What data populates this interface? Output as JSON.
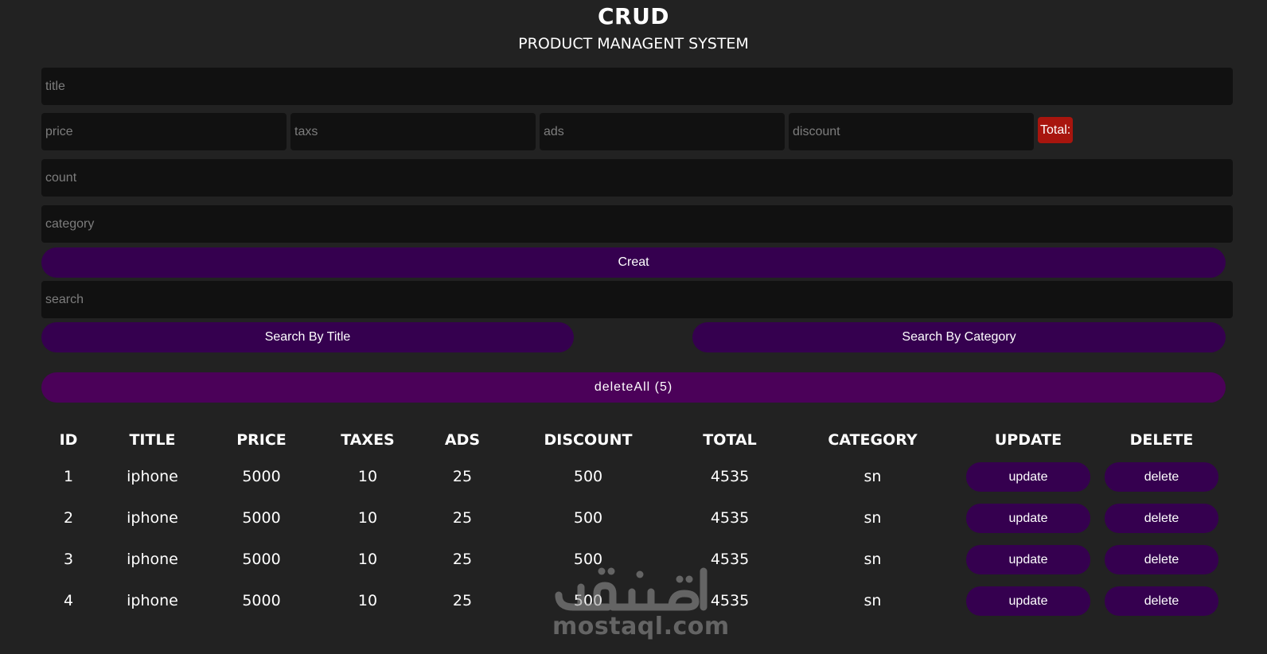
{
  "header": {
    "title": "CRUD",
    "subtitle": "PRODUCT MANAGENT SYSTEM"
  },
  "form": {
    "title_placeholder": "title",
    "price_placeholder": "price",
    "taxes_placeholder": "taxs",
    "ads_placeholder": "ads",
    "discount_placeholder": "discount",
    "total_label": "Total:",
    "count_placeholder": "count",
    "category_placeholder": "category",
    "create_label": "Creat"
  },
  "search": {
    "placeholder": "search",
    "by_title_label": "Search By Title",
    "by_category_label": "Search By Category"
  },
  "delete_all_label": "deleteAll (5)",
  "table": {
    "columns": [
      "ID",
      "TITLE",
      "PRICE",
      "TAXES",
      "ADS",
      "DISCOUNT",
      "TOTAL",
      "CATEGORY",
      "UPDATE",
      "DELETE"
    ],
    "rows": [
      {
        "id": "1",
        "title": "iphone",
        "price": "5000",
        "taxes": "10",
        "ads": "25",
        "discount": "500",
        "total": "4535",
        "category": "sn",
        "update_label": "update",
        "delete_label": "delete"
      },
      {
        "id": "2",
        "title": "iphone",
        "price": "5000",
        "taxes": "10",
        "ads": "25",
        "discount": "500",
        "total": "4535",
        "category": "sn",
        "update_label": "update",
        "delete_label": "delete"
      },
      {
        "id": "3",
        "title": "iphone",
        "price": "5000",
        "taxes": "10",
        "ads": "25",
        "discount": "500",
        "total": "4535",
        "category": "sn",
        "update_label": "update",
        "delete_label": "delete"
      },
      {
        "id": "4",
        "title": "iphone",
        "price": "5000",
        "taxes": "10",
        "ads": "25",
        "discount": "500",
        "total": "4535",
        "category": "sn",
        "update_label": "update",
        "delete_label": "delete"
      }
    ]
  },
  "watermark": {
    "text": "mostaql.com"
  },
  "colors": {
    "background": "#222222",
    "input_background": "#111111",
    "button_purple": "#35004f",
    "delete_all_purple": "#4b0159",
    "total_red": "#a8150e"
  }
}
